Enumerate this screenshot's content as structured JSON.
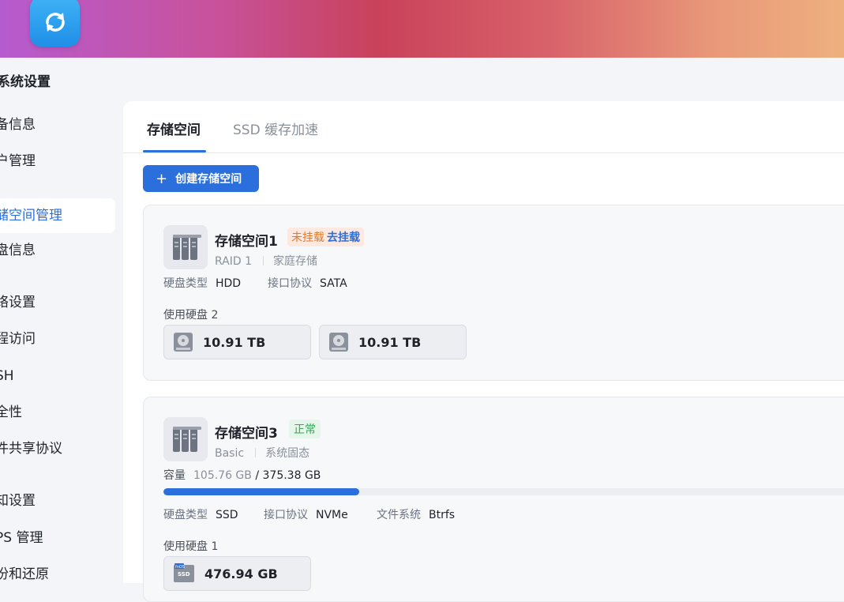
{
  "sidebar": {
    "title": "系统设置",
    "items": [
      {
        "label": "备信息"
      },
      {
        "label": "户管理"
      },
      {
        "label": "储空间管理"
      },
      {
        "label": "盘信息"
      },
      {
        "label": "络设置"
      },
      {
        "label": "程访问"
      },
      {
        "label": "SH"
      },
      {
        "label": "全性"
      },
      {
        "label": "件共享协议"
      },
      {
        "label": "知设置"
      },
      {
        "label": "PS 管理"
      },
      {
        "label": "份和还原"
      }
    ]
  },
  "tabs": [
    {
      "label": "存储空间"
    },
    {
      "label": "SSD 缓存加速"
    }
  ],
  "create_button": {
    "label": "创建存储空间"
  },
  "pools": [
    {
      "name": "存储空间1",
      "status_warning": "未挂载",
      "status_action": "去挂载",
      "raid": "RAID 1",
      "purpose": "家庭存储",
      "disk_type_label": "硬盘类型",
      "disk_type": "HDD",
      "interface_label": "接口协议",
      "interface": "SATA",
      "used_disks_label": "使用硬盘 2",
      "disks": [
        {
          "size": "10.91 TB",
          "icon": "hdd-icon"
        },
        {
          "size": "10.91 TB",
          "icon": "hdd-icon"
        }
      ]
    },
    {
      "name": "存储空间3",
      "status": "正常",
      "raid": "Basic",
      "purpose": "系统固态",
      "capacity_label": "容量",
      "capacity_used": "105.76 GB",
      "capacity_total": "/ 375.38 GB",
      "usage_fraction": 0.2817,
      "disk_type_label": "硬盘类型",
      "disk_type": "SSD",
      "interface_label": "接口协议",
      "interface": "NVMe",
      "filesystem_label": "文件系统",
      "filesystem": "Btrfs",
      "used_disks_label": "使用硬盘 1",
      "disks": [
        {
          "size": "476.94 GB",
          "icon": "ssd-icon",
          "badge": "fnOS",
          "badge2": "SSD"
        }
      ]
    }
  ],
  "colors": {
    "accent": "#2a6fdb",
    "warning": "#e07b2e",
    "ok": "#3aa55a"
  }
}
